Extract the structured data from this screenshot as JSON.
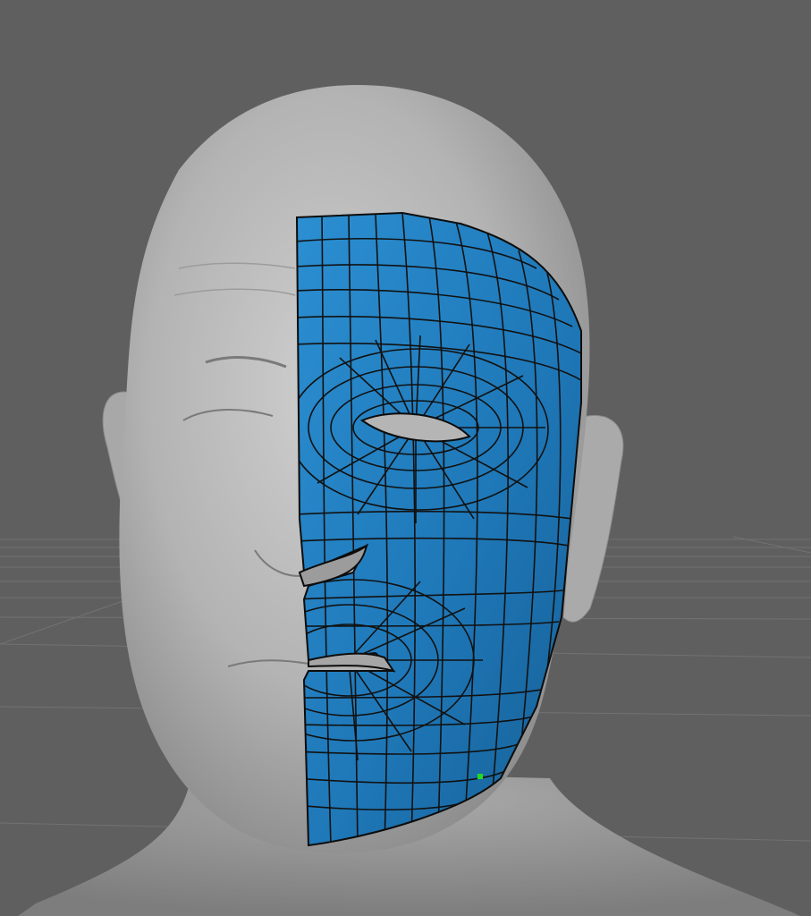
{
  "viewport": {
    "background_color": "#5f5f5f",
    "grid_color": "#6e6e6e"
  },
  "head_model": {
    "skin_color": "#b8b8b8",
    "shadow_color": "#7c7c7c"
  },
  "topology_mesh": {
    "fill_color": "#1f78b8",
    "fill_highlight": "#2b8fd2",
    "edge_color": "#111111"
  },
  "selection_vertex": {
    "color": "#22dd22"
  }
}
